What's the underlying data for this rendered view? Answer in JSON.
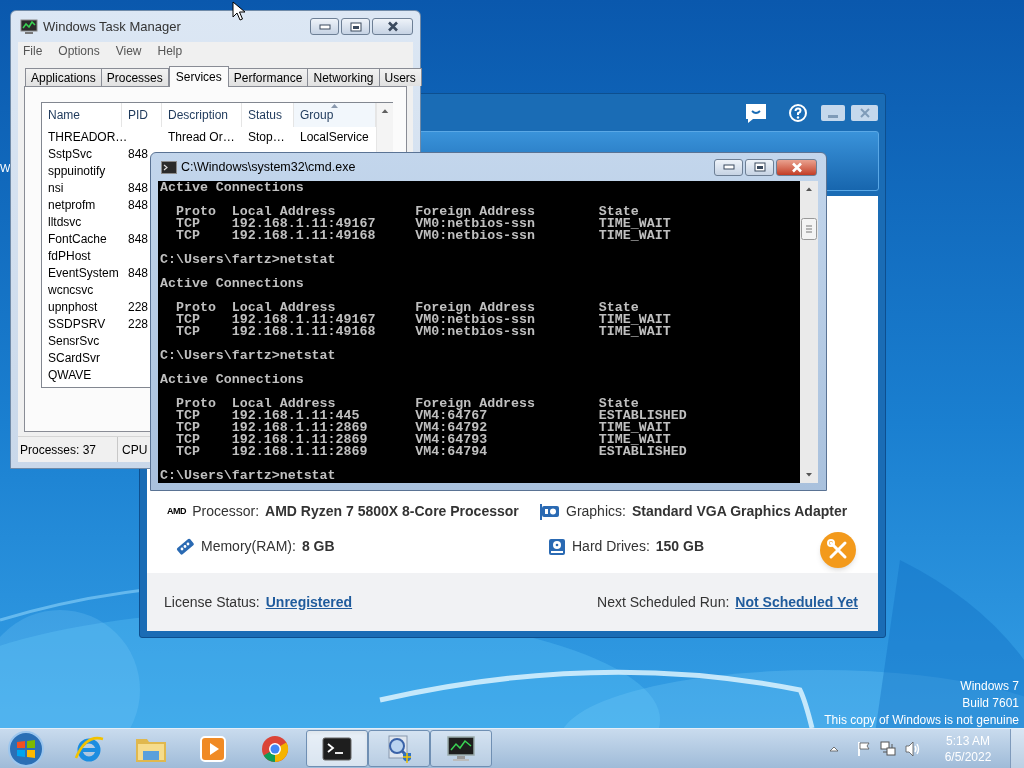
{
  "desktop": {
    "icon_label": "W",
    "watermark": [
      "Windows 7",
      "Build 7601",
      "This copy of Windows is not genuine"
    ]
  },
  "app_window": {
    "specs": [
      {
        "kind": "processor",
        "logo": "AMD",
        "label": "Processor:",
        "value": "AMD Ryzen 7 5800X 8-Core Processor"
      },
      {
        "kind": "graphics",
        "label": "Graphics:",
        "value": "Standard VGA Graphics Adapter"
      },
      {
        "kind": "memory",
        "label": "Memory(RAM):",
        "value": "8 GB"
      },
      {
        "kind": "disk",
        "label": "Hard Drives:",
        "value": "150 GB"
      }
    ],
    "footer": {
      "license_label": "License Status:",
      "license_link": "Unregistered",
      "schedule_label": "Next Scheduled Run:",
      "schedule_link": "Not Scheduled Yet"
    }
  },
  "task_manager": {
    "title": "Windows Task Manager",
    "menu": [
      "File",
      "Options",
      "View",
      "Help"
    ],
    "tabs": [
      {
        "label": "Applications",
        "selected": false
      },
      {
        "label": "Processes",
        "selected": false
      },
      {
        "label": "Services",
        "selected": true
      },
      {
        "label": "Performance",
        "selected": false
      },
      {
        "label": "Networking",
        "selected": false
      },
      {
        "label": "Users",
        "selected": false
      }
    ],
    "columns": [
      {
        "label": "Name",
        "sorted": false
      },
      {
        "label": "PID",
        "sorted": false
      },
      {
        "label": "Description",
        "sorted": false
      },
      {
        "label": "Status",
        "sorted": false
      },
      {
        "label": "Group",
        "sorted": true
      }
    ],
    "rows": [
      {
        "name": "THREADOR…",
        "description": "Thread Or…",
        "status": "Stop…",
        "group": "LocalService"
      },
      {
        "name": "SstpSvc",
        "pid": "848"
      },
      {
        "name": "sppuinotify"
      },
      {
        "name": "nsi",
        "pid": "848"
      },
      {
        "name": "netprofm",
        "pid": "848"
      },
      {
        "name": "lltdsvc"
      },
      {
        "name": "FontCache",
        "pid": "848"
      },
      {
        "name": "fdPHost"
      },
      {
        "name": "EventSystem",
        "pid": "848"
      },
      {
        "name": "wcncsvc"
      },
      {
        "name": "upnphost",
        "pid": "228"
      },
      {
        "name": "SSDPSRV",
        "pid": "228"
      },
      {
        "name": "SensrSvc"
      },
      {
        "name": "SCardSvr"
      },
      {
        "name": "QWAVE"
      }
    ],
    "status_bar": [
      "Processes: 37",
      "CPU"
    ]
  },
  "console": {
    "title": "C:\\Windows\\system32\\cmd.exe",
    "blocks": [
      {
        "heading": "Active Connections",
        "columns": [
          "Proto",
          "Local Address",
          "Foreign Address",
          "State"
        ],
        "rows": [
          [
            "TCP",
            "192.168.1.11:49167",
            "VM0:netbios-ssn",
            "TIME_WAIT"
          ],
          [
            "TCP",
            "192.168.1.11:49168",
            "VM0:netbios-ssn",
            "TIME_WAIT"
          ]
        ],
        "prompt": "C:\\Users\\fartz>netstat"
      },
      {
        "heading": "Active Connections",
        "columns": [
          "Proto",
          "Local Address",
          "Foreign Address",
          "State"
        ],
        "rows": [
          [
            "TCP",
            "192.168.1.11:49167",
            "VM0:netbios-ssn",
            "TIME_WAIT"
          ],
          [
            "TCP",
            "192.168.1.11:49168",
            "VM0:netbios-ssn",
            "TIME_WAIT"
          ]
        ],
        "prompt": "C:\\Users\\fartz>netstat"
      },
      {
        "heading": "Active Connections",
        "columns": [
          "Proto",
          "Local Address",
          "Foreign Address",
          "State"
        ],
        "rows": [
          [
            "TCP",
            "192.168.1.11:445",
            "VM4:64767",
            "ESTABLISHED"
          ],
          [
            "TCP",
            "192.168.1.11:2869",
            "VM4:64792",
            "TIME_WAIT"
          ],
          [
            "TCP",
            "192.168.1.11:2869",
            "VM4:64793",
            "TIME_WAIT"
          ],
          [
            "TCP",
            "192.168.1.11:2869",
            "VM4:64794",
            "ESTABLISHED"
          ]
        ],
        "prompt": "C:\\Users\\fartz>netstat"
      }
    ]
  },
  "taskbar": {
    "apps": [
      {
        "kind": "ie",
        "running": false,
        "selected": false
      },
      {
        "kind": "folder",
        "running": false,
        "selected": false
      },
      {
        "kind": "media",
        "running": false,
        "selected": false
      },
      {
        "kind": "chrome",
        "running": false,
        "selected": false
      },
      {
        "kind": "cmd",
        "running": true,
        "selected": true
      },
      {
        "kind": "inspector",
        "running": true,
        "selected": false
      },
      {
        "kind": "taskmgr",
        "running": true,
        "selected": false
      }
    ],
    "clock": {
      "time": "5:13 AM",
      "date": "6/5/2022"
    }
  }
}
